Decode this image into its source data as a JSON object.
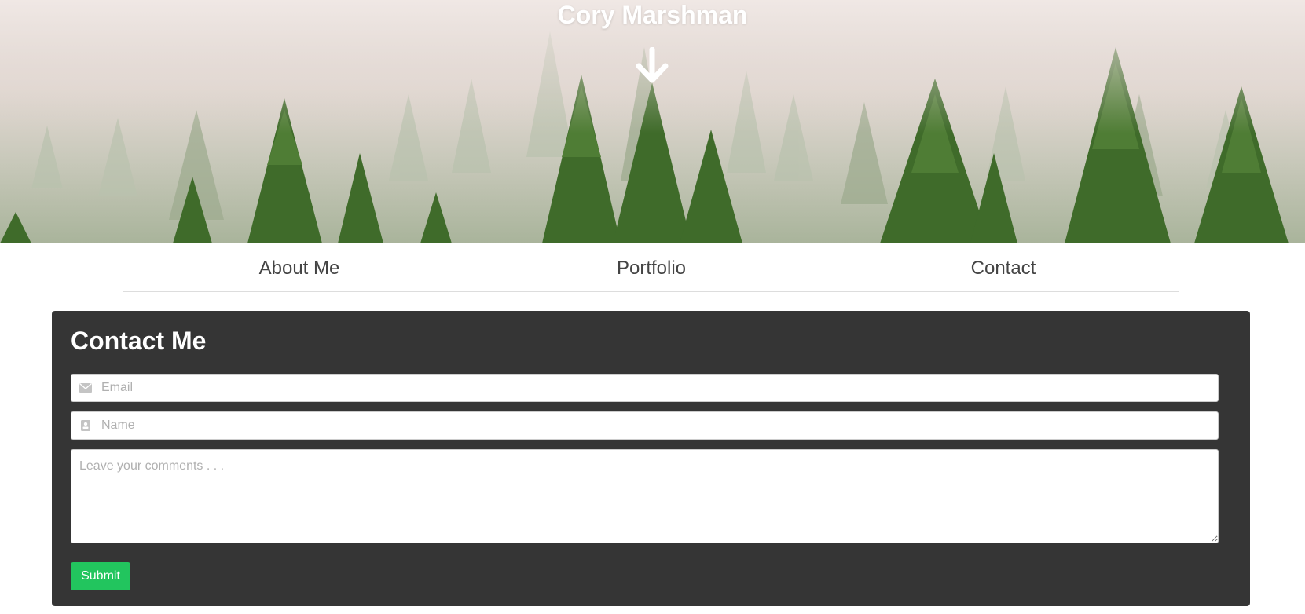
{
  "hero": {
    "title": "Cory Marshman",
    "background": "misty pine forest",
    "arrow_icon": "arrow-down-icon"
  },
  "nav": {
    "items": [
      {
        "label": "About Me"
      },
      {
        "label": "Portfolio"
      },
      {
        "label": "Contact"
      }
    ]
  },
  "contact": {
    "title": "Contact Me",
    "email": {
      "placeholder": "Email",
      "value": "",
      "icon": "envelope-icon"
    },
    "name": {
      "placeholder": "Name",
      "value": "",
      "icon": "contact-card-icon"
    },
    "comments": {
      "placeholder": "Leave your comments . . .",
      "value": ""
    },
    "submit_label": "Submit"
  },
  "colors": {
    "card_background": "#353535",
    "submit_button": "#22c55e",
    "nav_text": "#444444",
    "hero_text": "#ffffff"
  }
}
